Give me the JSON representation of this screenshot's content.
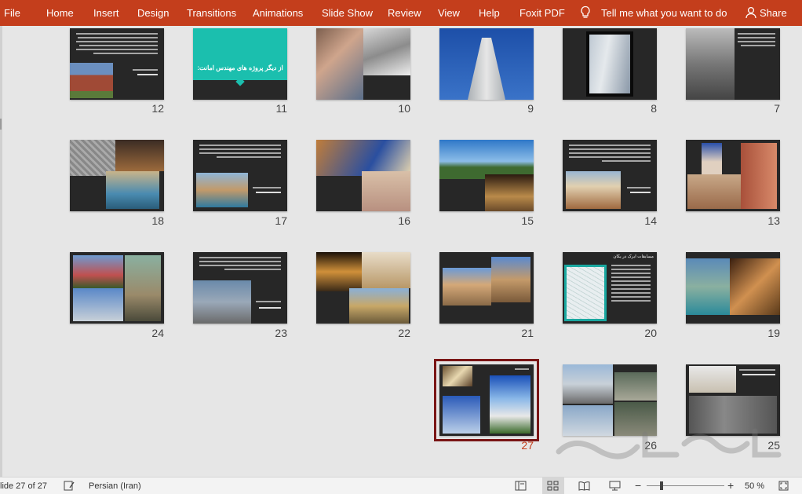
{
  "ribbon": {
    "tabs": [
      "File",
      "Home",
      "Insert",
      "Design",
      "Transitions",
      "Animations",
      "Slide Show",
      "Review",
      "View",
      "Help",
      "Foxit PDF"
    ],
    "tell_me": "Tell me what you want to do",
    "share": "Share"
  },
  "slides": [
    {
      "number": "12",
      "selected": false
    },
    {
      "number": "11",
      "selected": false,
      "title": "از دیگر پروژه های مهندس امانت:"
    },
    {
      "number": "10",
      "selected": false
    },
    {
      "number": "9",
      "selected": false
    },
    {
      "number": "8",
      "selected": false
    },
    {
      "number": "7",
      "selected": false
    },
    {
      "number": "18",
      "selected": false
    },
    {
      "number": "17",
      "selected": false
    },
    {
      "number": "16",
      "selected": false
    },
    {
      "number": "15",
      "selected": false
    },
    {
      "number": "14",
      "selected": false
    },
    {
      "number": "13",
      "selected": false
    },
    {
      "number": "24",
      "selected": false
    },
    {
      "number": "23",
      "selected": false
    },
    {
      "number": "22",
      "selected": false
    },
    {
      "number": "21",
      "selected": false
    },
    {
      "number": "20",
      "selected": false,
      "title": "مسابقات ابرک در یکان"
    },
    {
      "number": "19",
      "selected": false
    },
    {
      "number": "27",
      "selected": true
    },
    {
      "number": "26",
      "selected": false
    },
    {
      "number": "25",
      "selected": false
    }
  ],
  "status": {
    "slide_info": "lide 27 of 27",
    "language": "Persian (Iran)",
    "zoom": "50 %"
  },
  "colors": {
    "ribbon": "#c43e1c",
    "selection": "#7a1515",
    "slide_bg": "#272727"
  }
}
